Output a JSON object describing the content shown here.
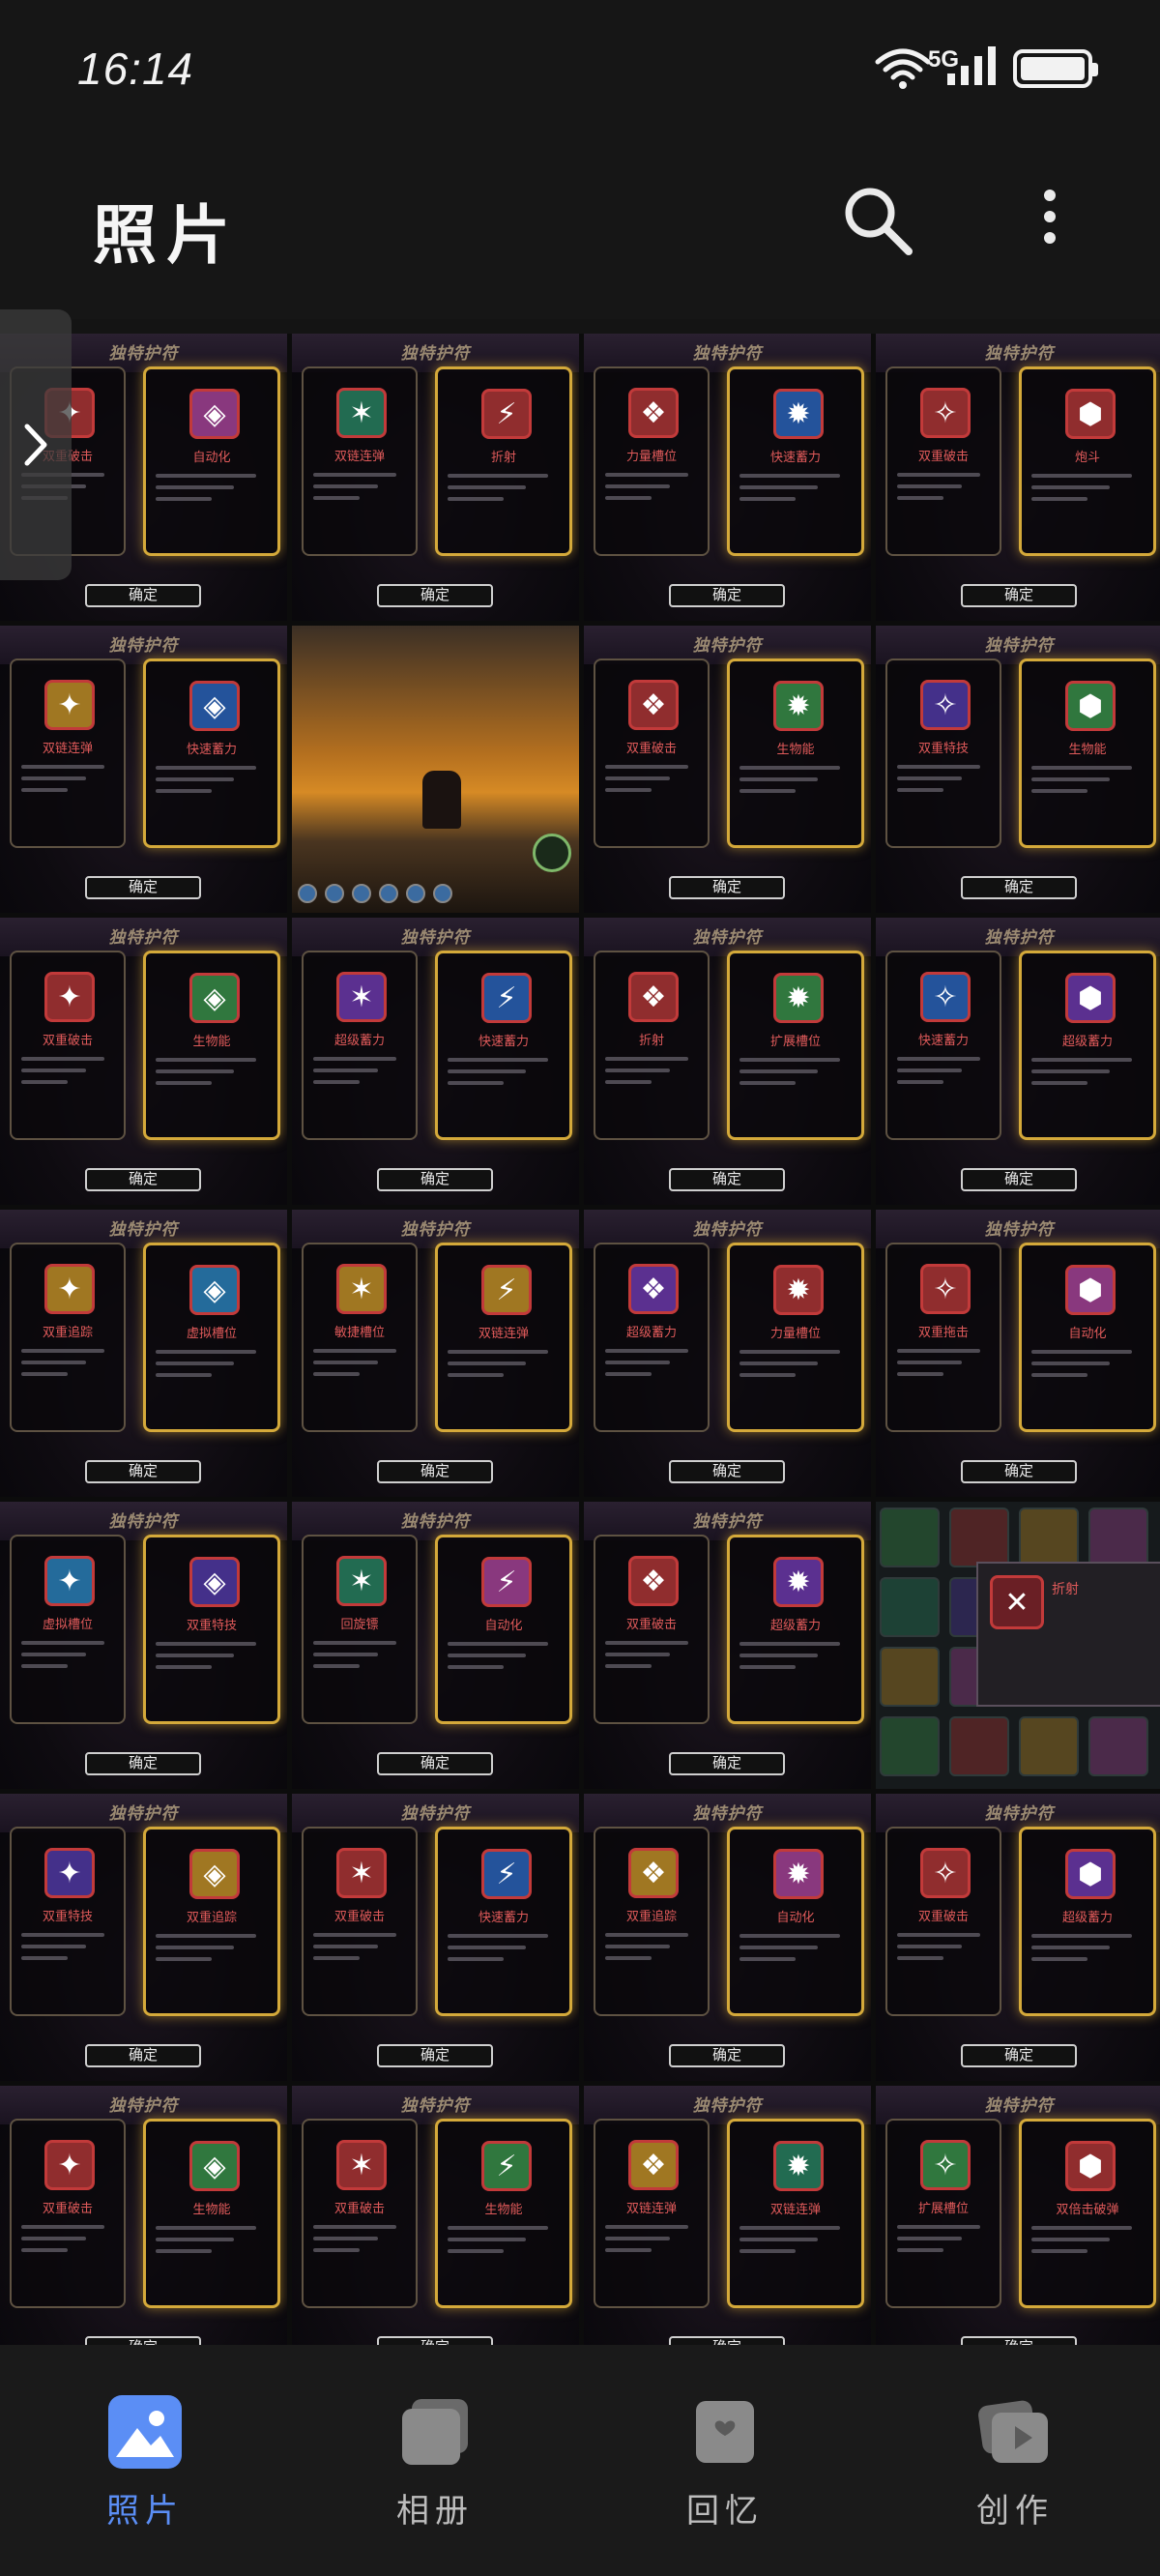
{
  "status": {
    "time": "16:14",
    "network": "5G"
  },
  "header": {
    "title": "照片"
  },
  "grid": {
    "banner_text": "独特护符",
    "confirm_label": "确定",
    "tiles": [
      {
        "kind": "card",
        "left": "双重破击",
        "right": "自动化",
        "lc": "#c23a3a",
        "rc": "#b84aa8"
      },
      {
        "kind": "card",
        "left": "双链连弹",
        "right": "折射",
        "lc": "#2c8f6a",
        "rc": "#c23a3a"
      },
      {
        "kind": "card",
        "left": "力量槽位",
        "right": "快速蓄力",
        "lc": "#c23a3a",
        "rc": "#2f6fcf"
      },
      {
        "kind": "card",
        "left": "双重破击",
        "right": "炮斗",
        "lc": "#c23a3a",
        "rc": "#c23a3a"
      },
      {
        "kind": "card",
        "left": "双链连弹",
        "right": "快速蓄力",
        "lc": "#d7a02a",
        "rc": "#2f6fcf"
      },
      {
        "kind": "game"
      },
      {
        "kind": "card",
        "left": "双重破击",
        "right": "生物能",
        "lc": "#c23a3a",
        "rc": "#3fa050"
      },
      {
        "kind": "card",
        "left": "双重特技",
        "right": "生物能",
        "lc": "#5a3fb8",
        "rc": "#3fa050"
      },
      {
        "kind": "card",
        "left": "双重破击",
        "right": "生物能",
        "lc": "#c23a3a",
        "rc": "#3fa050"
      },
      {
        "kind": "card",
        "left": "超级蓄力",
        "right": "快速蓄力",
        "lc": "#7a3fc0",
        "rc": "#2f6fcf"
      },
      {
        "kind": "card",
        "left": "折射",
        "right": "扩展槽位",
        "lc": "#c23a3a",
        "rc": "#3fa050"
      },
      {
        "kind": "card",
        "left": "快速蓄力",
        "right": "超级蓄力",
        "lc": "#2f6fcf",
        "rc": "#7a3fc0"
      },
      {
        "kind": "card",
        "left": "双重追踪",
        "right": "虚拟槽位",
        "lc": "#d7a02a",
        "rc": "#2f8fcf"
      },
      {
        "kind": "card",
        "left": "敏捷槽位",
        "right": "双链连弹",
        "lc": "#d7a02a",
        "rc": "#d7a02a"
      },
      {
        "kind": "card",
        "left": "超级蓄力",
        "right": "力量槽位",
        "lc": "#7a3fc0",
        "rc": "#c23a3a"
      },
      {
        "kind": "card",
        "left": "双重拖击",
        "right": "自动化",
        "lc": "#c23a3a",
        "rc": "#b84aa8"
      },
      {
        "kind": "card",
        "left": "虚拟槽位",
        "right": "双重特技",
        "lc": "#2f8fcf",
        "rc": "#5a3fb8"
      },
      {
        "kind": "card",
        "left": "回旋镖",
        "right": "自动化",
        "lc": "#2c8f6a",
        "rc": "#b84aa8"
      },
      {
        "kind": "card",
        "left": "双重破击",
        "right": "超级蓄力",
        "lc": "#c23a3a",
        "rc": "#7a3fc0"
      },
      {
        "kind": "inventory",
        "popup": "折射"
      },
      {
        "kind": "card",
        "left": "双重特技",
        "right": "双重追踪",
        "lc": "#5a3fb8",
        "rc": "#d7a02a"
      },
      {
        "kind": "card",
        "left": "双重破击",
        "right": "快速蓄力",
        "lc": "#c23a3a",
        "rc": "#2f6fcf"
      },
      {
        "kind": "card",
        "left": "双重追踪",
        "right": "自动化",
        "lc": "#d7a02a",
        "rc": "#b84aa8"
      },
      {
        "kind": "card",
        "left": "双重破击",
        "right": "超级蓄力",
        "lc": "#c23a3a",
        "rc": "#7a3fc0"
      },
      {
        "kind": "card",
        "left": "双重破击",
        "right": "生物能",
        "lc": "#c23a3a",
        "rc": "#3fa050"
      },
      {
        "kind": "card",
        "left": "双重破击",
        "right": "生物能",
        "lc": "#c23a3a",
        "rc": "#3fa050"
      },
      {
        "kind": "card",
        "left": "双链连弹",
        "right": "双链连弹",
        "lc": "#d7a02a",
        "rc": "#2c8f6a"
      },
      {
        "kind": "card",
        "left": "扩展槽位",
        "right": "双倍击破弹",
        "lc": "#3fa050",
        "rc": "#c23a3a"
      }
    ]
  },
  "nav": {
    "items": [
      {
        "label": "照片",
        "icon": "photo-icon",
        "active": true
      },
      {
        "label": "相册",
        "icon": "album-icon",
        "active": false
      },
      {
        "label": "回忆",
        "icon": "memories-icon",
        "active": false
      },
      {
        "label": "创作",
        "icon": "create-icon",
        "active": false
      }
    ],
    "active_color": "#5b8ef5",
    "inactive_color": "#bdbdbd"
  }
}
